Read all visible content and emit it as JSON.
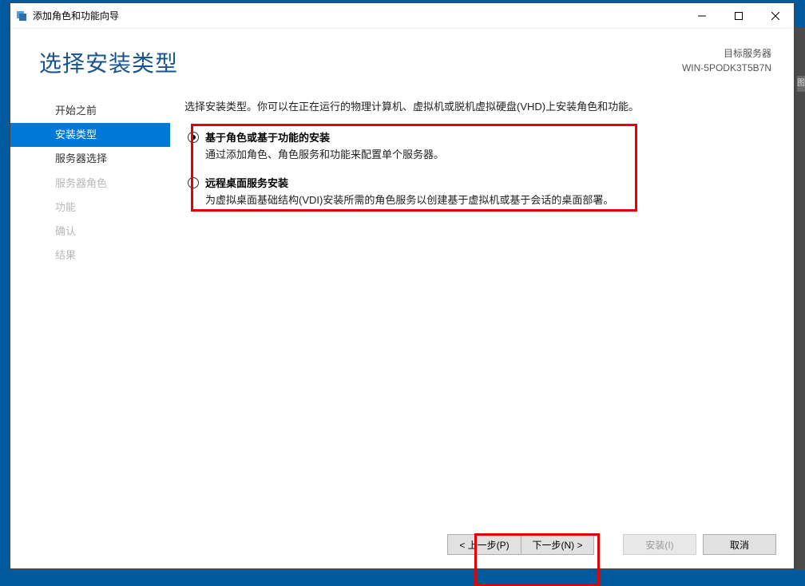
{
  "titlebar": {
    "title": "添加角色和功能向导"
  },
  "header": {
    "page_title": "选择安装类型",
    "target_label": "目标服务器",
    "target_server": "WIN-5PODK3T5B7N"
  },
  "sidebar": {
    "items": [
      {
        "label": "开始之前",
        "state": "normal"
      },
      {
        "label": "安装类型",
        "state": "selected"
      },
      {
        "label": "服务器选择",
        "state": "normal"
      },
      {
        "label": "服务器角色",
        "state": "disabled"
      },
      {
        "label": "功能",
        "state": "disabled"
      },
      {
        "label": "确认",
        "state": "disabled"
      },
      {
        "label": "结果",
        "state": "disabled"
      }
    ]
  },
  "main": {
    "intro": "选择安装类型。你可以在正在运行的物理计算机、虚拟机或脱机虚拟硬盘(VHD)上安装角色和功能。",
    "options": [
      {
        "title": "基于角色或基于功能的安装",
        "desc": "通过添加角色、角色服务和功能来配置单个服务器。",
        "checked": true
      },
      {
        "title": "远程桌面服务安装",
        "desc": "为虚拟桌面基础结构(VDI)安装所需的角色服务以创建基于虚拟机或基于会话的桌面部署。",
        "checked": false
      }
    ]
  },
  "footer": {
    "prev": "< 上一步(P)",
    "next": "下一步(N) >",
    "install": "安装(I)",
    "cancel": "取消"
  },
  "edge_char": "图"
}
